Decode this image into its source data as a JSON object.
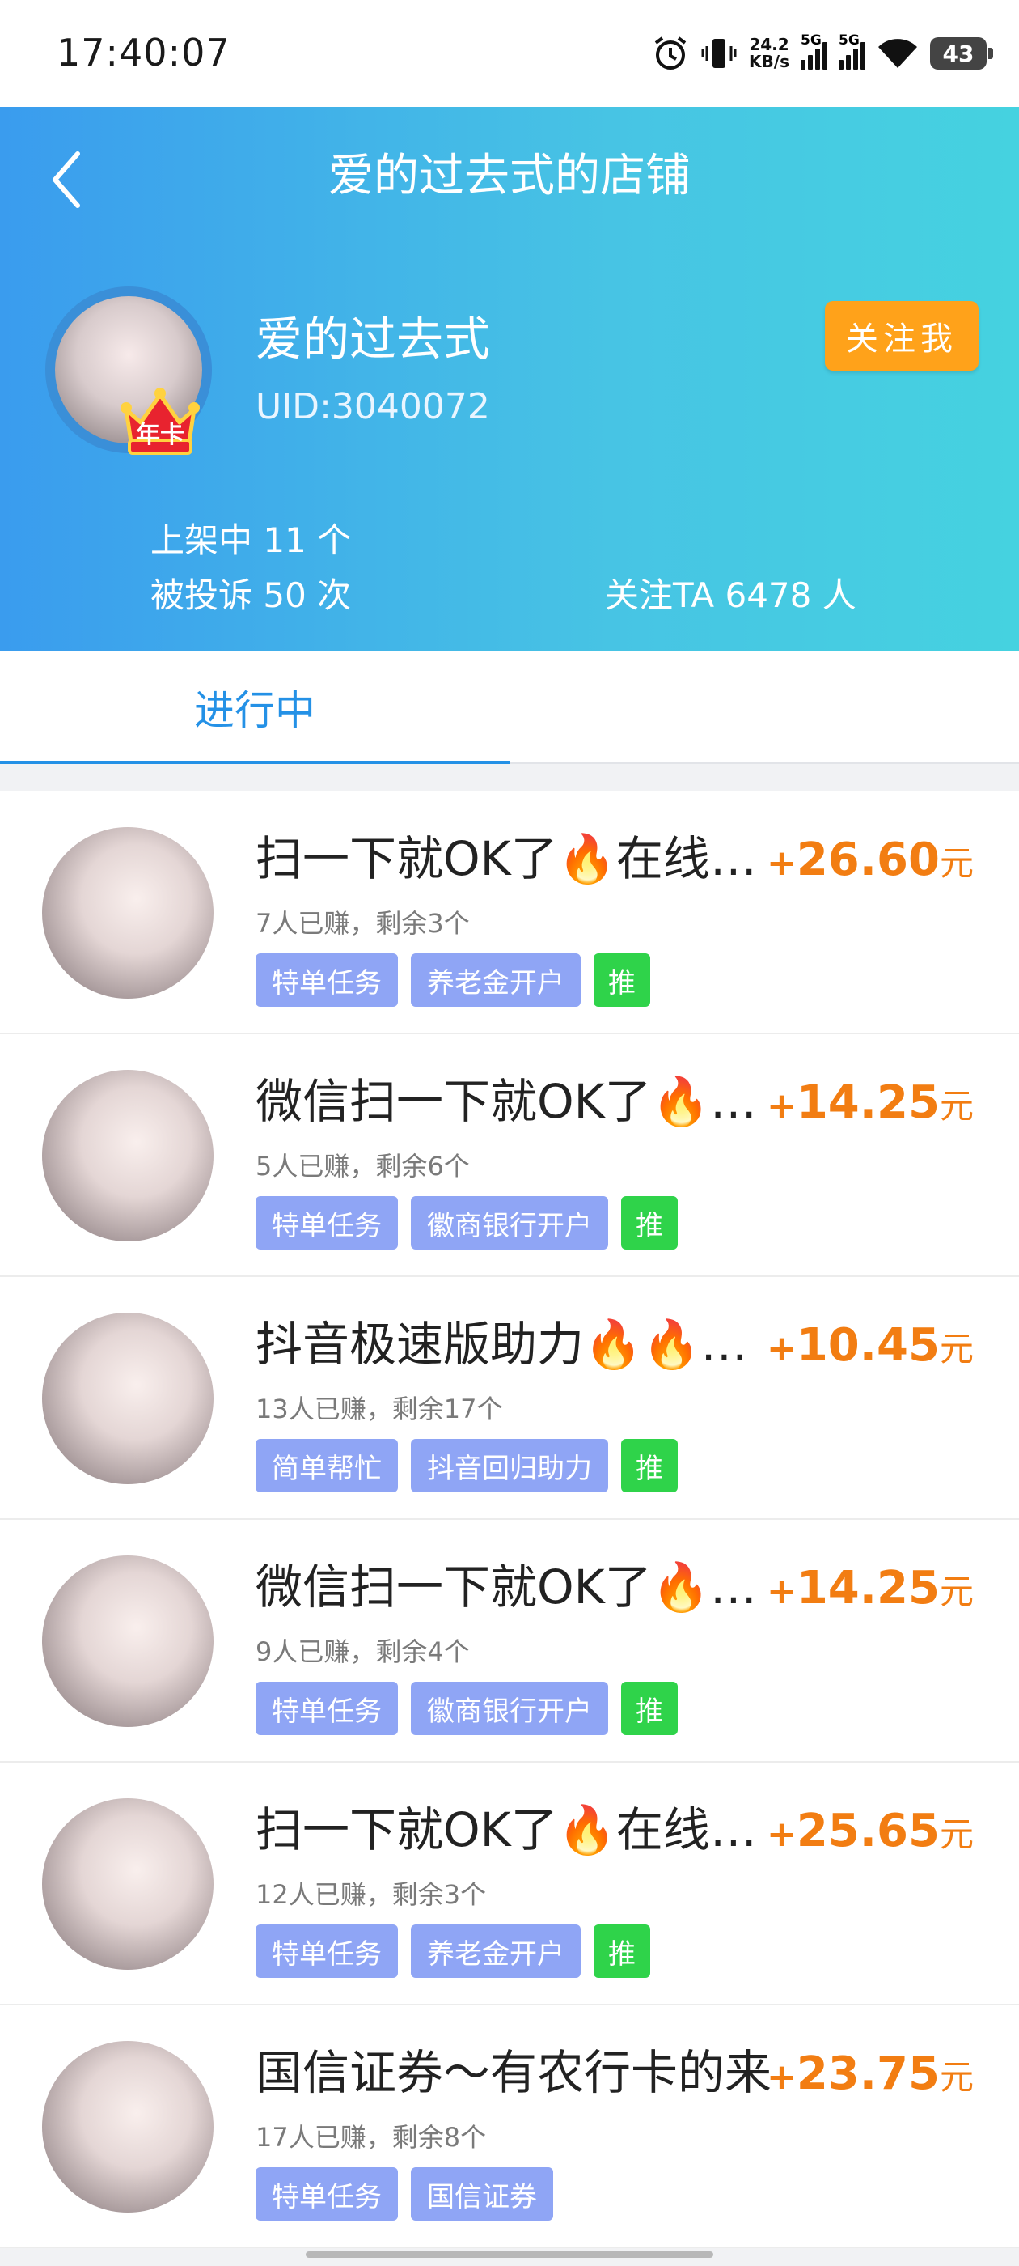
{
  "status_bar": {
    "time": "17:40:07",
    "net_speed_value": "24.2",
    "net_speed_unit": "KB/s",
    "signal1_label": "5G",
    "signal2_label": "5G",
    "battery": "43",
    "icons": [
      "alarm-icon",
      "vibrate-icon",
      "signal-icon",
      "wifi-icon",
      "battery-icon"
    ]
  },
  "header": {
    "title": "爱的过去式的店铺",
    "shop_name": "爱的过去式",
    "uid": "UID:3040072",
    "crown_label": "年卡",
    "follow_label": "关注我",
    "stats": {
      "listed": "上架中 11 个",
      "complaints": "被投诉 50 次",
      "followers": "关注TA 6478 人"
    },
    "gradient_start": "#3a9cee",
    "gradient_end": "#45d2e0"
  },
  "tabs": [
    {
      "label": "进行中",
      "active": true
    }
  ],
  "tasks": [
    {
      "title": "扫一下就OK了🔥在线…",
      "sub": "7人已赚，剩余3个",
      "tags": [
        "特单任务",
        "养老金开户"
      ],
      "rec": "推",
      "plus": "+",
      "amount": "26.60",
      "unit": "元"
    },
    {
      "title": "微信扫一下就OK了🔥…",
      "sub": "5人已赚，剩余6个",
      "tags": [
        "特单任务",
        "徽商银行开户"
      ],
      "rec": "推",
      "plus": "+",
      "amount": "14.25",
      "unit": "元"
    },
    {
      "title": "抖音极速版助力🔥🔥…",
      "sub": "13人已赚，剩余17个",
      "tags": [
        "简单帮忙",
        "抖音回归助力"
      ],
      "rec": "推",
      "plus": "+",
      "amount": "10.45",
      "unit": "元"
    },
    {
      "title": "微信扫一下就OK了🔥…",
      "sub": "9人已赚，剩余4个",
      "tags": [
        "特单任务",
        "徽商银行开户"
      ],
      "rec": "推",
      "plus": "+",
      "amount": "14.25",
      "unit": "元"
    },
    {
      "title": "扫一下就OK了🔥在线…",
      "sub": "12人已赚，剩余3个",
      "tags": [
        "特单任务",
        "养老金开户"
      ],
      "rec": "推",
      "plus": "+",
      "amount": "25.65",
      "unit": "元"
    },
    {
      "title": "国信证券～有农行卡的来",
      "sub": "17人已赚，剩余8个",
      "tags": [
        "特单任务",
        "国信证券"
      ],
      "rec": "",
      "plus": "+",
      "amount": "23.75",
      "unit": "元"
    }
  ],
  "colors": {
    "accent": "#2491e6",
    "reward": "#f27d12",
    "tag": "#8fa5f5",
    "rec_tag": "#2fd34a",
    "follow": "#ffa21a"
  }
}
